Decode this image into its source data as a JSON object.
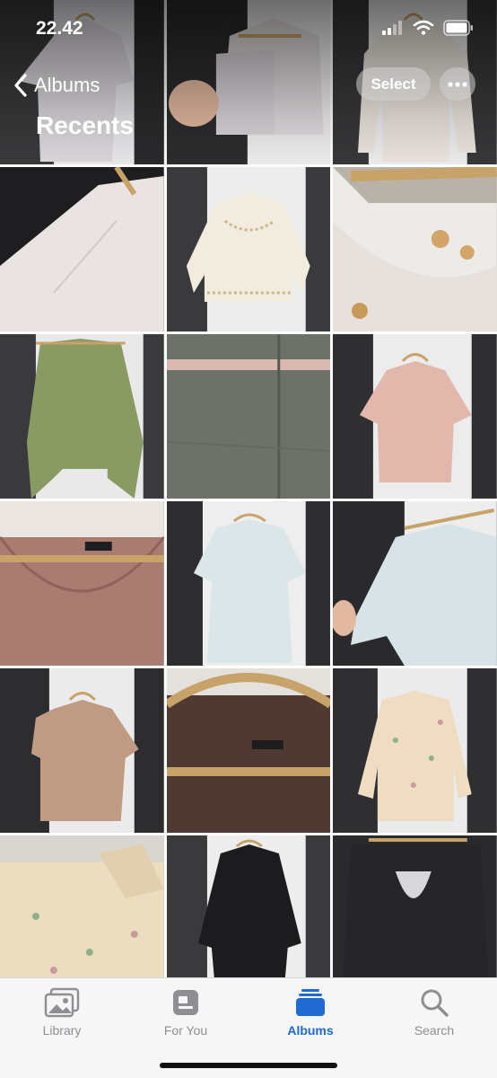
{
  "status": {
    "time": "22.42"
  },
  "nav": {
    "back_label": "Albums",
    "title": "Recents",
    "select_label": "Select"
  },
  "tabs": [
    {
      "label": "Library",
      "icon": "photo-library-icon",
      "active": false
    },
    {
      "label": "For You",
      "icon": "for-you-icon",
      "active": false
    },
    {
      "label": "Albums",
      "icon": "albums-icon",
      "active": true
    },
    {
      "label": "Search",
      "icon": "search-icon",
      "active": false
    }
  ],
  "colors": {
    "accent": "#1f6bd1",
    "inactive": "#8e8e93"
  },
  "photos": [
    {
      "name": "photo-white-top-hanger"
    },
    {
      "name": "photo-white-top-held"
    },
    {
      "name": "photo-white-blouse"
    },
    {
      "name": "photo-fabric-closeup"
    },
    {
      "name": "photo-cream-cutout-top"
    },
    {
      "name": "photo-cutout-detail"
    },
    {
      "name": "photo-green-cardigan"
    },
    {
      "name": "photo-grey-knit-closeup"
    },
    {
      "name": "photo-pink-tshirt"
    },
    {
      "name": "photo-mauve-neckline"
    },
    {
      "name": "photo-light-blue-dress"
    },
    {
      "name": "photo-light-blue-held"
    },
    {
      "name": "photo-tan-vneck-top"
    },
    {
      "name": "photo-brown-neckline"
    },
    {
      "name": "photo-floral-shirt"
    },
    {
      "name": "photo-floral-collar"
    },
    {
      "name": "photo-black-lace-dress"
    },
    {
      "name": "photo-black-lace-back"
    }
  ]
}
